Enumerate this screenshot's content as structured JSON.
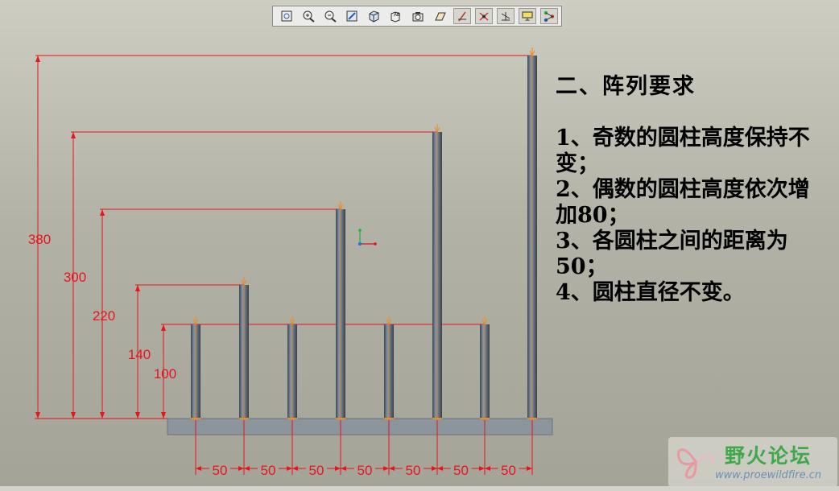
{
  "toolbar": {
    "buttons": [
      {
        "name": "refit-button",
        "icon": "refit-icon"
      },
      {
        "name": "zoom-in-button",
        "icon": "zoom-in-icon"
      },
      {
        "name": "zoom-out-button",
        "icon": "zoom-out-icon"
      },
      {
        "name": "repaint-button",
        "icon": "repaint-icon"
      },
      {
        "name": "display-style-button",
        "icon": "cube-icon"
      },
      {
        "name": "saved-views-button",
        "icon": "saved-views-icon"
      },
      {
        "name": "view-manager-button",
        "icon": "camera-icon"
      },
      {
        "name": "datum-planes-button",
        "icon": "datum-plane-icon"
      },
      {
        "name": "datum-axes-button",
        "icon": "datum-axis-icon"
      },
      {
        "name": "datum-points-button",
        "icon": "datum-point-icon"
      },
      {
        "name": "coordinate-systems-button",
        "icon": "coordinate-system-icon"
      },
      {
        "name": "annotations-button",
        "icon": "annotation-icon"
      },
      {
        "name": "spin-center-button",
        "icon": "spin-center-icon"
      }
    ]
  },
  "drawing": {
    "height_dims": [
      "380",
      "300",
      "220",
      "140",
      "100"
    ],
    "spacing_dims": [
      "50",
      "50",
      "50",
      "50",
      "50",
      "50",
      "50"
    ],
    "colors": {
      "dimension": "#e8141e",
      "cylinder": "#6f7b88",
      "base": "#8c949c",
      "marker": "#f08a1c"
    }
  },
  "notes": {
    "title": "二、阵列要求",
    "items": [
      "1、奇数的圆柱高度保持不变；",
      "2、偶数的圆柱高度依次增加80；",
      "3、各圆柱之间的距离为50；",
      "4、圆柱直径不变。"
    ]
  },
  "watermark": {
    "name": "野火论坛",
    "url": "www.proewildfire.cn"
  }
}
